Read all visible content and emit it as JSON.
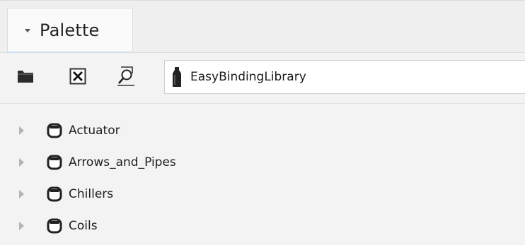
{
  "palette": {
    "title": "Palette"
  },
  "toolbar": {
    "open_icon": "folder-icon",
    "close_icon": "close-box-icon",
    "find_icon": "find-icon",
    "library_icon": "library-jar-icon",
    "library_value": "EasyBindingLibrary"
  },
  "tree": {
    "items": [
      {
        "label": "Actuator",
        "icon": "module-icon"
      },
      {
        "label": "Arrows_and_Pipes",
        "icon": "module-icon"
      },
      {
        "label": "Chillers",
        "icon": "module-icon"
      },
      {
        "label": "Coils",
        "icon": "module-icon"
      }
    ]
  },
  "colors": {
    "background": "#f3f3f3",
    "icon_dark": "#2b2b2b",
    "expander": "#b4b4b4",
    "tab_accent": "#cfe0f0"
  }
}
